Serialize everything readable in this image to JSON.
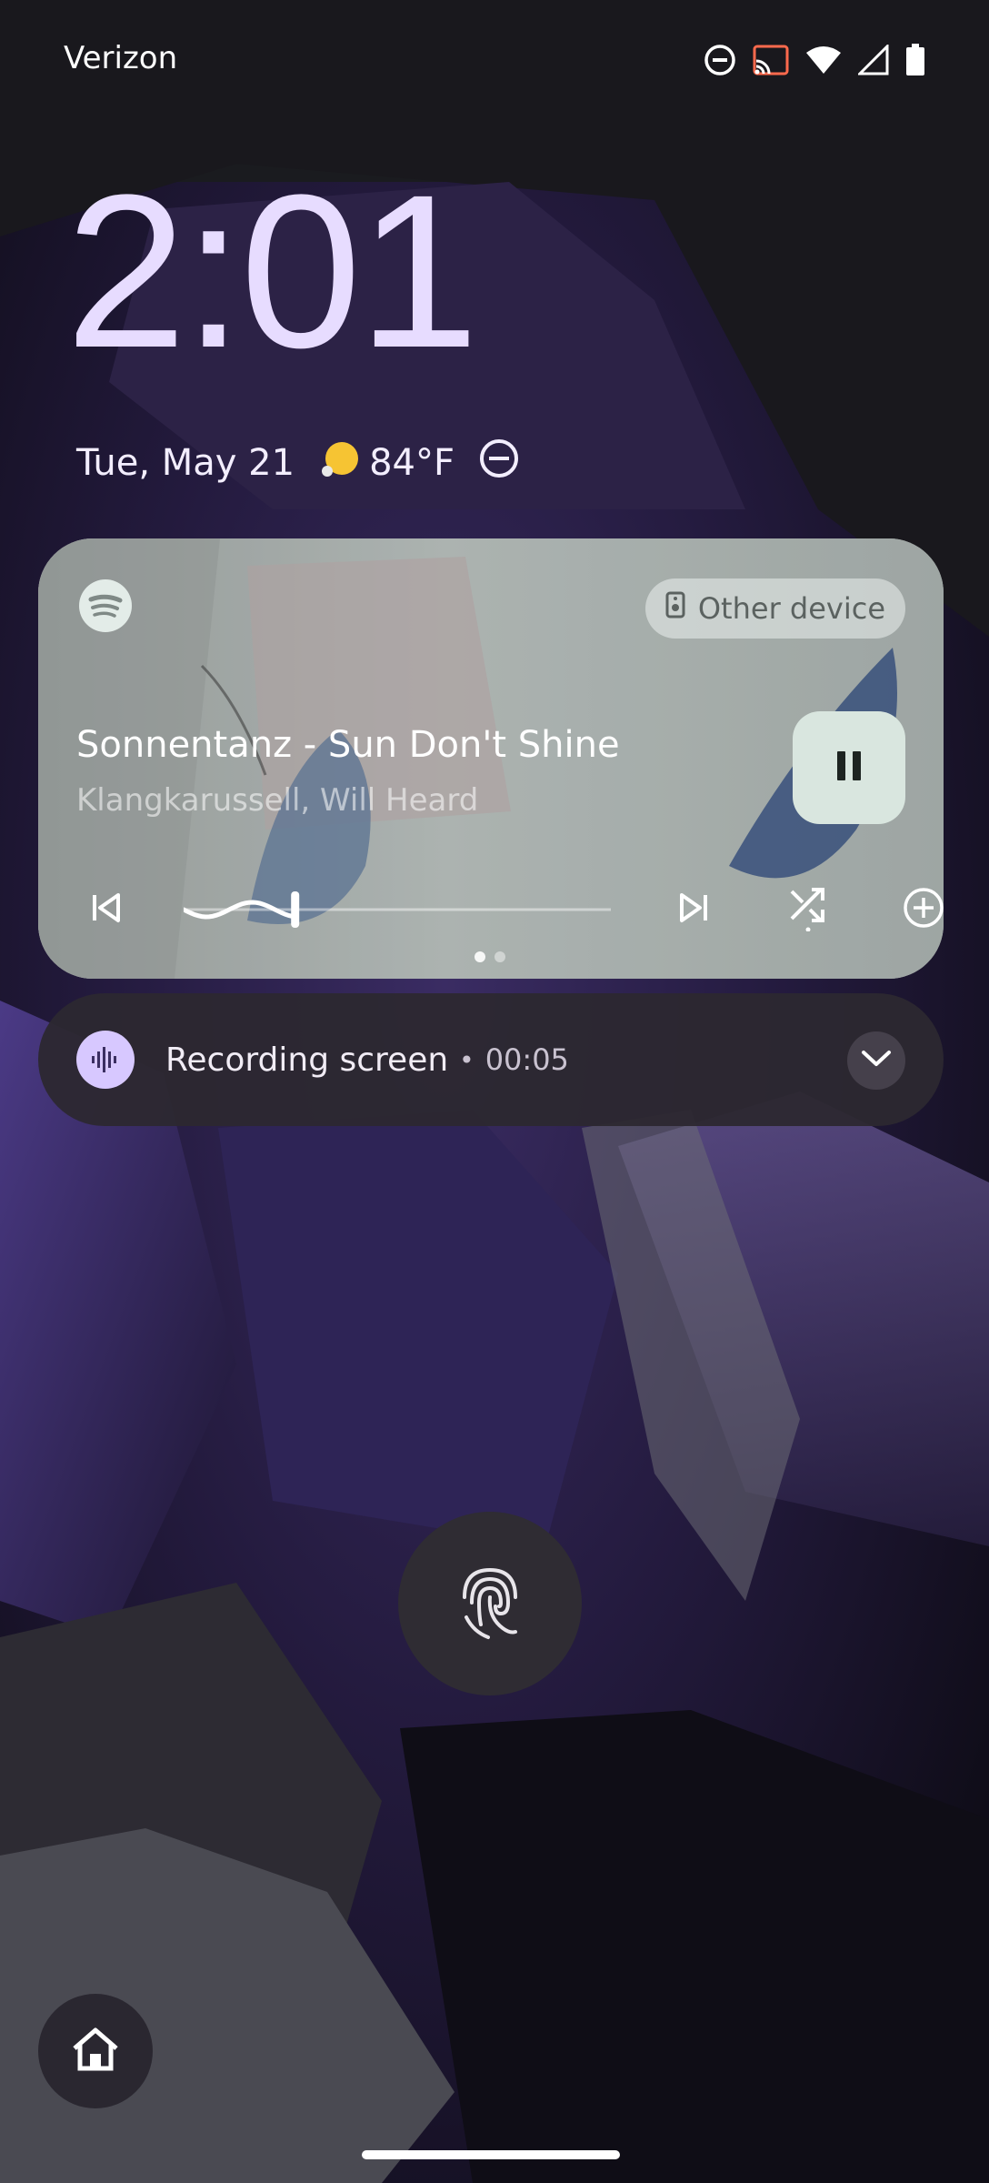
{
  "status_bar": {
    "carrier": "Verizon",
    "icons": [
      "do-not-disturb-icon",
      "cast-icon",
      "wifi-icon",
      "cell-signal-icon",
      "battery-icon"
    ]
  },
  "lockscreen": {
    "time": "2:01",
    "date": "Tue, May 21",
    "weather_icon": "sun-icon",
    "temperature": "84°F",
    "dnd_icon": "do-not-disturb-icon"
  },
  "media": {
    "app_icon": "spotify-icon",
    "output_device": "Other device",
    "title": "Sonnentanz - Sun Don't Shine",
    "artist": "Klangkarussell, Will Heard",
    "progress": 0.26,
    "page_count": 2,
    "page_index": 0,
    "controls": [
      "previous-icon",
      "pause-icon",
      "next-icon",
      "shuffle-icon",
      "add-icon"
    ]
  },
  "recording": {
    "title": "Recording screen",
    "separator": "•",
    "elapsed": "00:05"
  },
  "colors": {
    "clock": "#e7dcff",
    "recording_icon_bg": "#d7c8ff",
    "pause_button_bg": "#d9e6df"
  }
}
